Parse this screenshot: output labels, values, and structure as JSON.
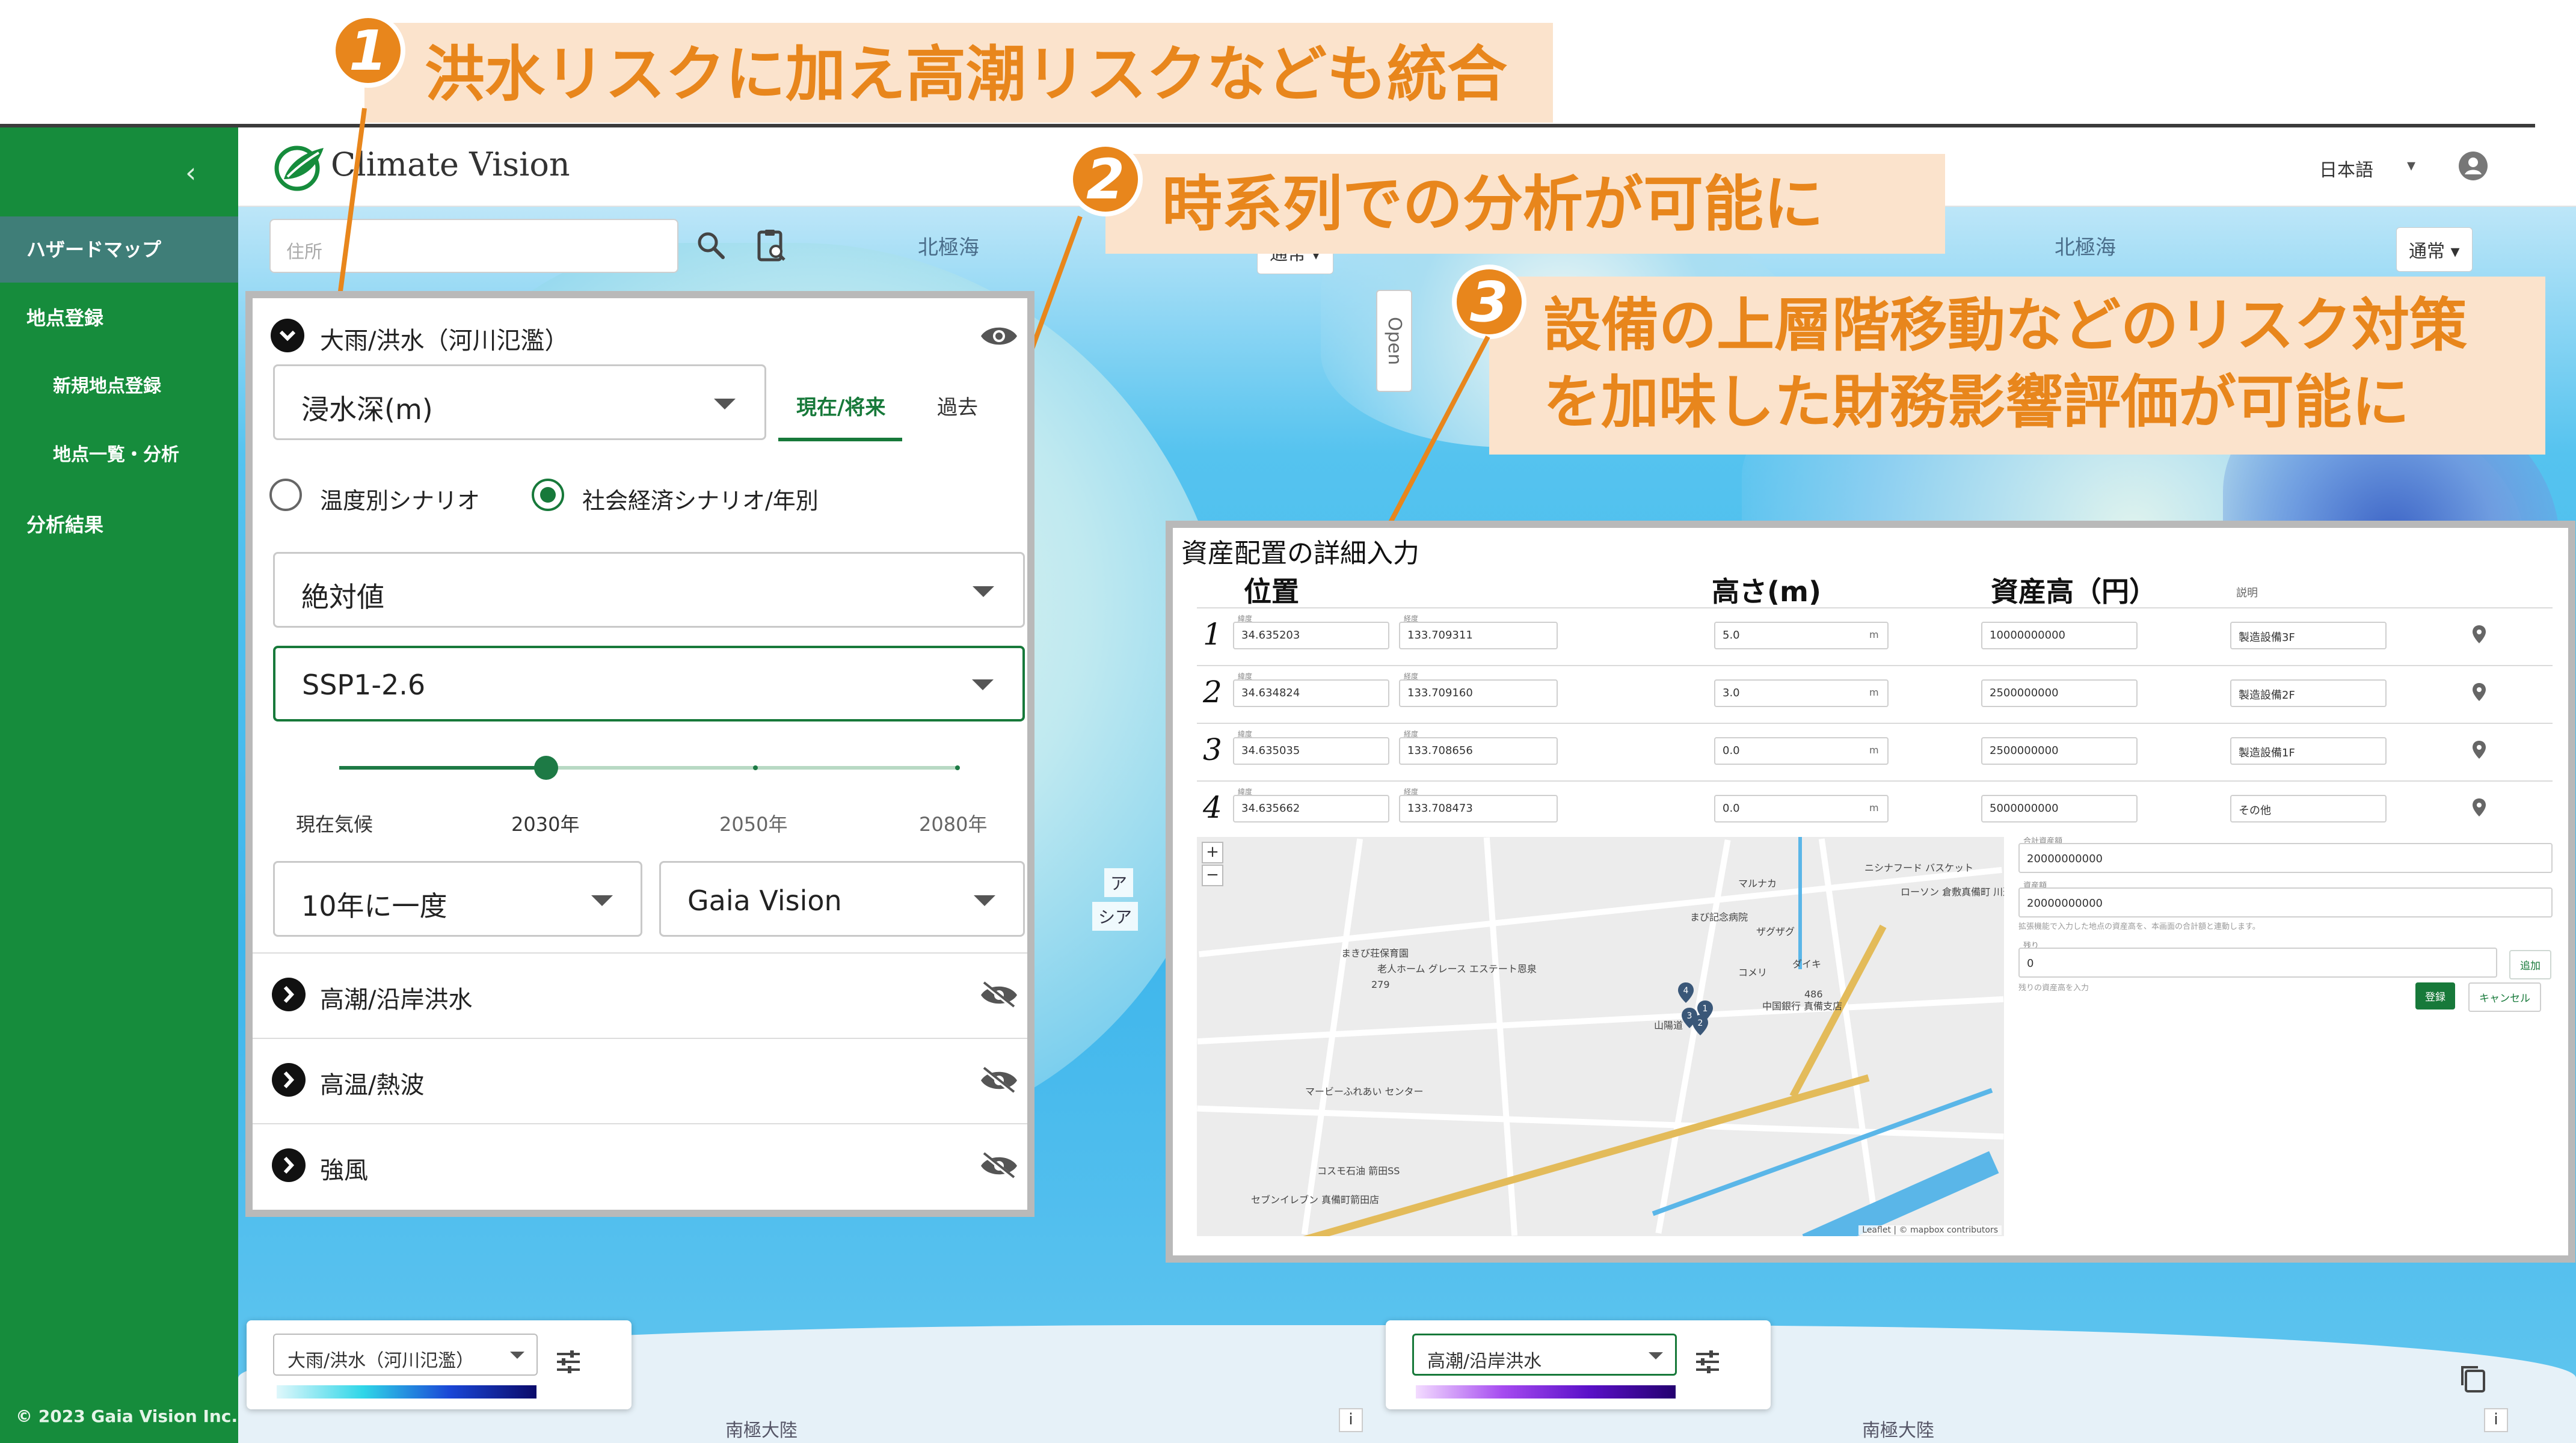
{
  "callouts": [
    {
      "number": "1",
      "text": "洪水リスクに加え高潮リスクなども統合"
    },
    {
      "number": "2",
      "text": "時系列での分析が可能に"
    },
    {
      "number": "3",
      "line1": "設備の上層階移動などのリスク対策",
      "line2": "を加味した財務影響評価が可能に"
    }
  ],
  "sidebar": {
    "items": [
      {
        "label": "ハザードマップ",
        "active": true
      },
      {
        "label": "地点登録"
      },
      {
        "label": "新規地点登録"
      },
      {
        "label": "地点一覧・分析"
      },
      {
        "label": "分析結果"
      }
    ],
    "copyright": "© 2023 Gaia Vision Inc."
  },
  "header": {
    "app_title": "Climate Vision",
    "language": "日本語"
  },
  "map": {
    "search_placeholder": "住所",
    "view_mode_left": "通常",
    "view_mode_right": "通常",
    "open_tab": "Open",
    "sea_labels": [
      "北極海",
      "北極海"
    ],
    "continent_labels": [
      "南極大陸",
      "南極大陸"
    ],
    "map_tags": [
      "ア",
      "シア"
    ],
    "info": "i"
  },
  "hazard_panel": {
    "sections": [
      {
        "title": "大雨/洪水（河川氾濫）",
        "expanded": true,
        "visible": true
      },
      {
        "title": "高潮/沿岸洪水",
        "expanded": false,
        "visible": false
      },
      {
        "title": "高温/熱波",
        "expanded": false,
        "visible": false
      },
      {
        "title": "強風",
        "expanded": false,
        "visible": false
      }
    ],
    "metric": "浸水深(m)",
    "tabs": [
      {
        "label": "現在/将来",
        "active": true
      },
      {
        "label": "過去"
      }
    ],
    "scenario_options": [
      {
        "label": "温度別シナリオ",
        "selected": false
      },
      {
        "label": "社会経済シナリオ/年別",
        "selected": true
      }
    ],
    "value_type": "絶対値",
    "ssp": "SSP1-2.6",
    "timeline": {
      "ticks": [
        "現在気候",
        "2030年",
        "2050年",
        "2080年"
      ],
      "selected_index": 1
    },
    "frequency": "10年に一度",
    "model": "Gaia Vision"
  },
  "asset_dialog": {
    "title": "資産配置の詳細入力",
    "headers": {
      "position": "位置",
      "height": "高さ(m)",
      "asset_value": "資産高（円）",
      "description": "説明"
    },
    "caption_lat": "緯度",
    "caption_lon": "経度",
    "unit": "m",
    "rows": [
      {
        "num": "1",
        "lat": "34.635203",
        "lon": "133.709311",
        "height": "5.0",
        "value": "10000000000",
        "desc": "製造設備3F"
      },
      {
        "num": "2",
        "lat": "34.634824",
        "lon": "133.709160",
        "height": "3.0",
        "value": "2500000000",
        "desc": "製造設備2F"
      },
      {
        "num": "3",
        "lat": "34.635035",
        "lon": "133.708656",
        "height": "0.0",
        "value": "2500000000",
        "desc": "製造設備1F"
      },
      {
        "num": "4",
        "lat": "34.635662",
        "lon": "133.708473",
        "height": "0.0",
        "value": "5000000000",
        "desc": "その他"
      }
    ],
    "map_labels": [
      "ニシナフード バスケット",
      "マルナカ",
      "まび記念病院",
      "ザグザグ",
      "ダイキ",
      "コメリ",
      "中国銀行 真備支店",
      "ローソン 倉敷真備町 川辺店",
      "まきび荘保育園",
      "老人ホーム グレース エステート恩泉",
      "マービーふれあい センター",
      "コスモ石油 箭田SS",
      "セブンイレブン 真備町箭田店",
      "山陽道",
      "279",
      "486"
    ],
    "attribution": "Leaflet | © mapbox contributors",
    "marker_nums": [
      "4",
      "1",
      "3",
      "2"
    ],
    "form": {
      "total_label": "合計資産額",
      "total_value": "20000000000",
      "asset_label": "資産額",
      "asset_value": "20000000000",
      "note1": "拡張機能で入力した地点の資産高を、本画面の合計額と連動します。",
      "remain_label": "残り",
      "remain_value": "0",
      "add": "追加",
      "note2": "残りの資産高を入力",
      "register": "登録",
      "cancel": "キャンセル"
    }
  },
  "legends": [
    {
      "label": "大雨/洪水（河川氾濫）"
    },
    {
      "label": "高潮/沿岸洪水"
    }
  ],
  "colors": {
    "sidebar": "#168c3c",
    "accent": "#17793a",
    "callout": "#e8861c",
    "callout_bg": "#fbe3cc"
  }
}
